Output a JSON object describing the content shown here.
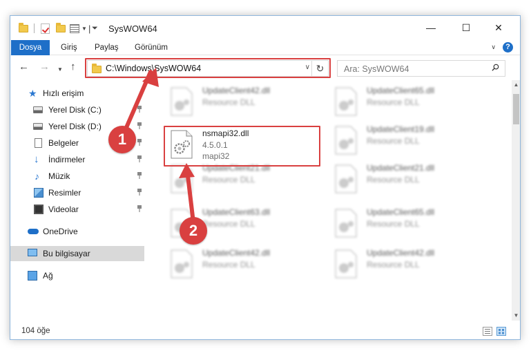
{
  "window": {
    "title": "SysWOW64",
    "controls": {
      "minimize": "—",
      "maximize": "☐",
      "close": "✕"
    }
  },
  "ribbon": {
    "tabs": [
      {
        "label": "Dosya"
      },
      {
        "label": "Giriş"
      },
      {
        "label": "Paylaş"
      },
      {
        "label": "Görünüm"
      }
    ],
    "help_label": "?"
  },
  "navigation": {
    "address_path": "C:\\Windows\\SysWOW64",
    "search_placeholder": "Ara: SysWOW64"
  },
  "sidebar": {
    "items": [
      {
        "label": "Hızlı erişim",
        "icon": "star-icon"
      },
      {
        "label": "Yerel Disk (C:)",
        "icon": "drive-icon",
        "pinned": true
      },
      {
        "label": "Yerel Disk (D:)",
        "icon": "drive-icon",
        "pinned": true
      },
      {
        "label": "Belgeler",
        "icon": "documents-icon",
        "pinned": true
      },
      {
        "label": "İndirmeler",
        "icon": "downloads-icon",
        "pinned": true
      },
      {
        "label": "Müzik",
        "icon": "music-icon",
        "pinned": true
      },
      {
        "label": "Resimler",
        "icon": "pictures-icon",
        "pinned": true
      },
      {
        "label": "Videolar",
        "icon": "videos-icon",
        "pinned": true
      },
      {
        "label": "OneDrive",
        "icon": "onedrive-icon"
      },
      {
        "label": "Bu bilgisayar",
        "icon": "this-pc-icon",
        "selected": true
      },
      {
        "label": "Ağ",
        "icon": "network-icon"
      }
    ]
  },
  "files": {
    "highlighted": {
      "name": "nsmapi32.dll",
      "version": "4.5.0.1",
      "description": "mapi32"
    },
    "background_left": [
      {
        "name": "UpdateClient42.dll",
        "type": "Resource DLL"
      },
      {
        "name": "UpdateClient21.dll",
        "type": "Resource DLL"
      },
      {
        "name": "UpdateClient63.dll",
        "type": "Resource DLL"
      },
      {
        "name": "UpdateClient42.dll",
        "type": "Resource DLL"
      }
    ],
    "background_right": [
      {
        "name": "UpdateClient65.dll",
        "type": "Resource DLL"
      },
      {
        "name": "UpdateClient19.dll",
        "type": "Resource DLL"
      },
      {
        "name": "UpdateClient21.dll",
        "type": "Resource DLL"
      },
      {
        "name": "UpdateClient65.dll",
        "type": "Resource DLL"
      },
      {
        "name": "UpdateClient42.dll",
        "type": "Resource DLL"
      }
    ]
  },
  "status": {
    "item_count": "104 öğe"
  },
  "callouts": [
    {
      "number": "1"
    },
    {
      "number": "2"
    }
  ],
  "colors": {
    "accent": "#1e6fc8",
    "highlight": "#d94040"
  }
}
